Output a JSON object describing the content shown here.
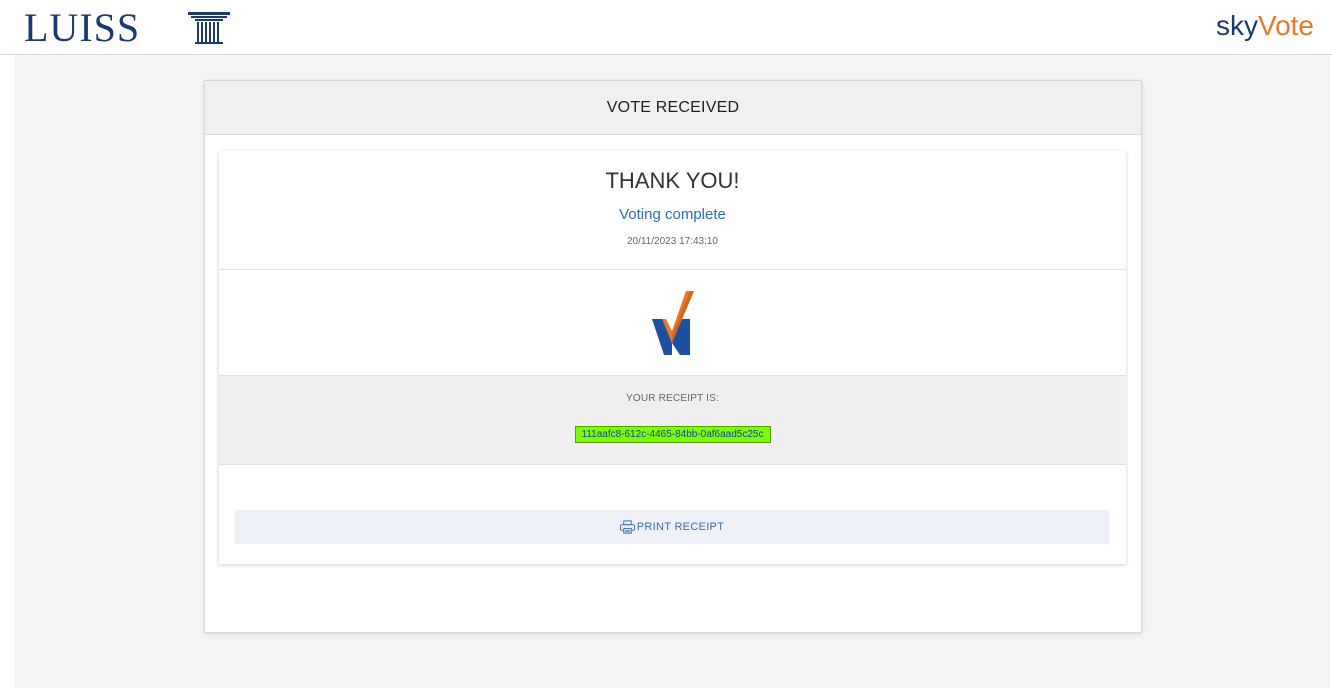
{
  "header": {
    "university_name": "LUISS",
    "app_logo_part1": "sky",
    "app_logo_part2": "Vote",
    "colors": {
      "navy": "#1d3a6d",
      "orange": "#e8782a"
    }
  },
  "card": {
    "title": "VOTE RECEIVED",
    "thanks_title": "THANK YOU!",
    "status": "Voting complete",
    "timestamp": "20/11/2023 17:43:10",
    "logo_icon": "skyvote-check-icon",
    "receipt_label": "YOUR RECEIPT IS:",
    "receipt_code": "111aafc8-612c-4465-84bb-0af6aad5c25c",
    "print_label": "PRINT RECEIPT",
    "print_icon": "printer-icon"
  }
}
